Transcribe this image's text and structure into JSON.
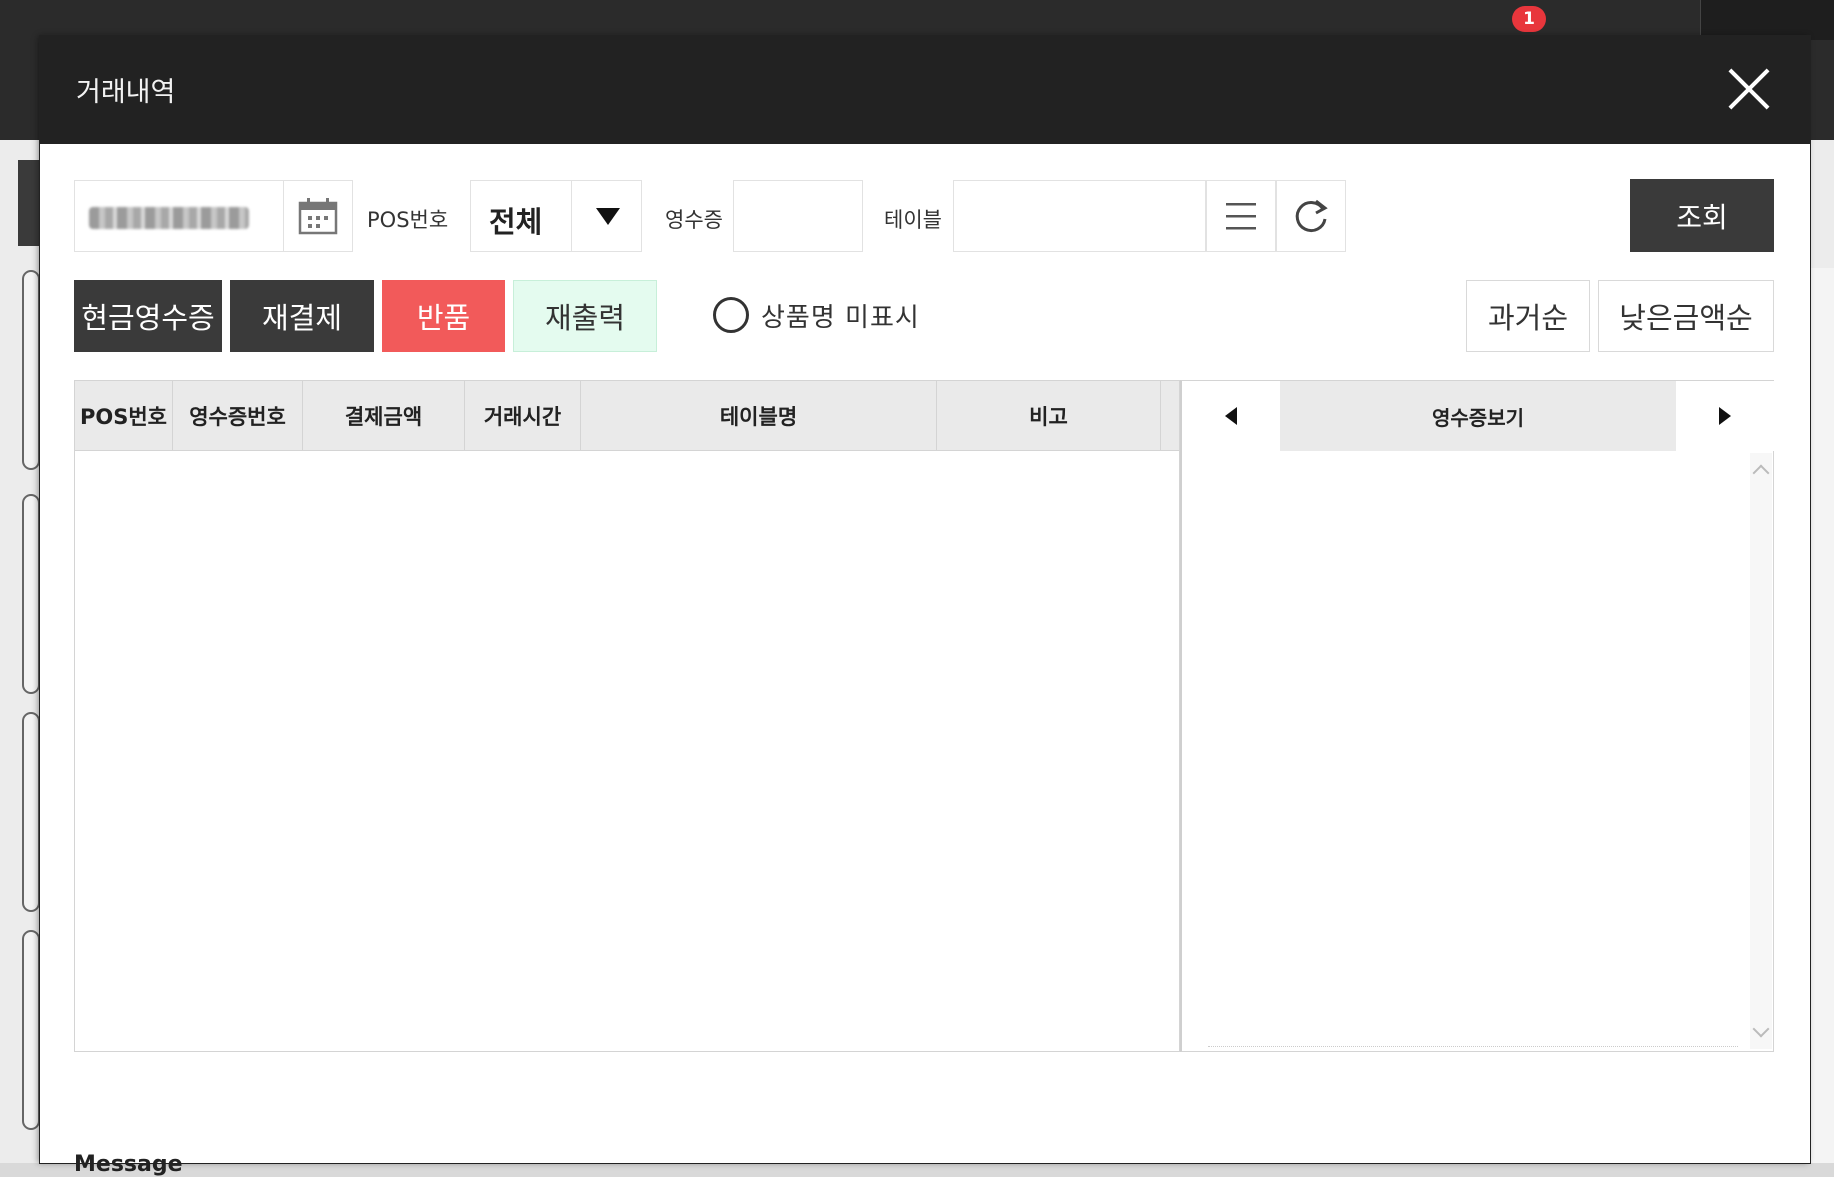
{
  "background": {
    "notification_count": "1"
  },
  "modal": {
    "title": "거래내역",
    "filters": {
      "date_icon": "calendar-icon",
      "pos_label": "POS번호",
      "pos_selected": "전체",
      "receipt_label": "영수증",
      "receipt_value": "",
      "table_label": "테이블",
      "table_value": "",
      "menu_icon": "menu-icon",
      "refresh_icon": "refresh-icon",
      "search_label": "조회"
    },
    "actions": {
      "cash_receipt": "현금영수증",
      "repay": "재결제",
      "return": "반품",
      "reprint": "재출력",
      "hide_item_names": "상품명 미표시",
      "sort_past": "과거순",
      "sort_low_amount": "낮은금액순"
    },
    "table": {
      "columns": [
        "POS번호",
        "영수증번호",
        "결제금액",
        "거래시간",
        "테이블명",
        "비고"
      ],
      "rows": []
    },
    "receipt_panel": {
      "title": "영수증보기"
    },
    "message_label": "Message"
  },
  "colors": {
    "header_bg": "#222222",
    "dark_button": "#3a3a3a",
    "return_button": "#f25a5a",
    "reprint_button": "#e4fbef",
    "notification": "#e8363c"
  }
}
